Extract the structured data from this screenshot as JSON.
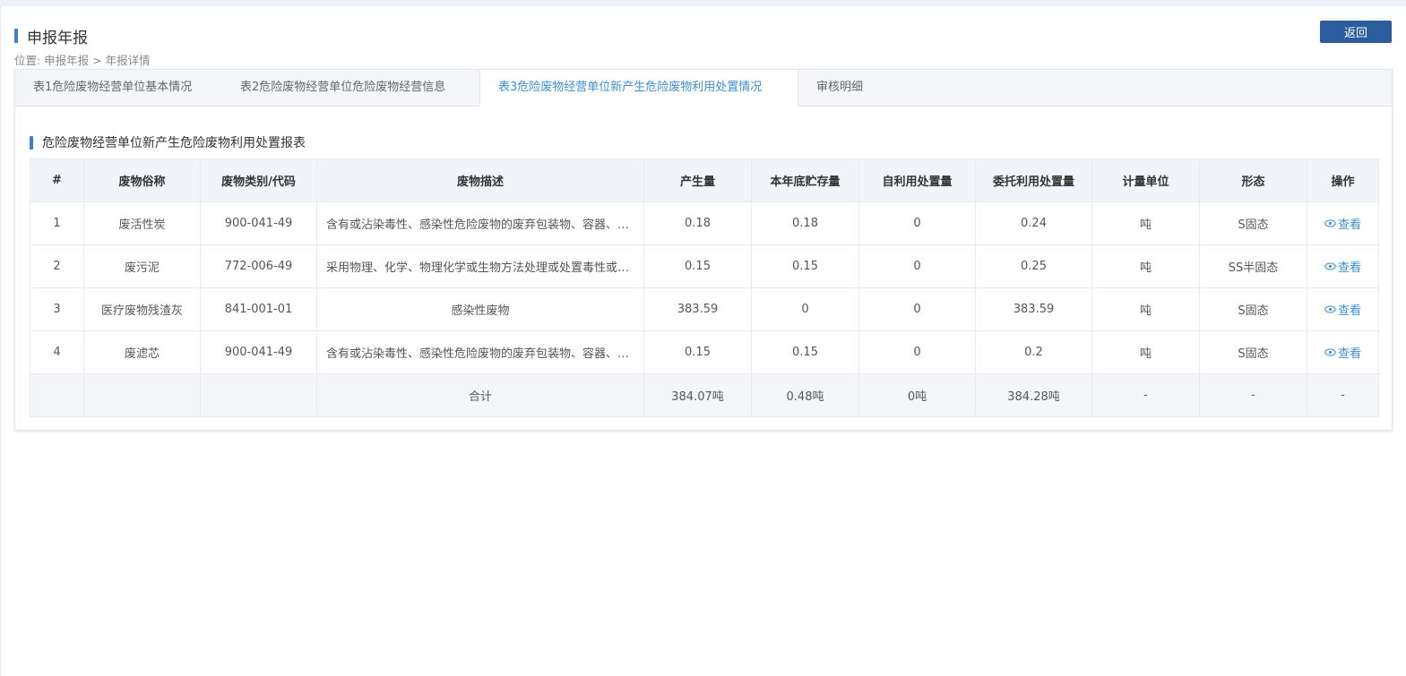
{
  "header": {
    "title": "申报年报",
    "back_label": "返回",
    "breadcrumb": "位置: 申报年报 > 年报详情"
  },
  "tabs": [
    {
      "label": "表1危险废物经营单位基本情况",
      "active": false
    },
    {
      "label": "表2危险废物经营单位危险废物经营信息",
      "active": false
    },
    {
      "label": "表3危险废物经营单位新产生危险废物利用处置情况",
      "active": true
    },
    {
      "label": "审核明细",
      "active": false
    }
  ],
  "section": {
    "title": "危险废物经营单位新产生危险废物利用处置报表"
  },
  "table": {
    "columns": [
      "#",
      "废物俗称",
      "废物类别/代码",
      "废物描述",
      "产生量",
      "本年底贮存量",
      "自利用处置量",
      "委托利用处置量",
      "计量单位",
      "形态",
      "操作"
    ],
    "rows": [
      [
        "1",
        "废活性炭",
        "900-041-49",
        "含有或沾染毒性、感染性危险废物的废弃包装物、容器、过滤吸附介质",
        "0.18",
        "0.18",
        "0",
        "0.24",
        "吨",
        "S固态",
        "查看"
      ],
      [
        "2",
        "废污泥",
        "772-006-49",
        "采用物理、化学、物理化学或生物方法处理或处置毒性或感染性危险废物",
        "0.15",
        "0.15",
        "0",
        "0.25",
        "吨",
        "SS半固态",
        "查看"
      ],
      [
        "3",
        "医疗废物残渣灰",
        "841-001-01",
        "感染性废物",
        "383.59",
        "0",
        "0",
        "383.59",
        "吨",
        "S固态",
        "查看"
      ],
      [
        "4",
        "废滤芯",
        "900-041-49",
        "含有或沾染毒性、感染性危险废物的废弃包装物、容器、过滤吸附介质",
        "0.15",
        "0.15",
        "0",
        "0.2",
        "吨",
        "S固态",
        "查看"
      ]
    ],
    "total": [
      "",
      "",
      "",
      "合计",
      "384.07吨",
      "0.48吨",
      "0吨",
      "384.28吨",
      "-",
      "-",
      "-"
    ]
  },
  "colors": {
    "accent": "#3d8fd6",
    "button": "#2b5d9e",
    "marker": "#3a7fd5"
  }
}
